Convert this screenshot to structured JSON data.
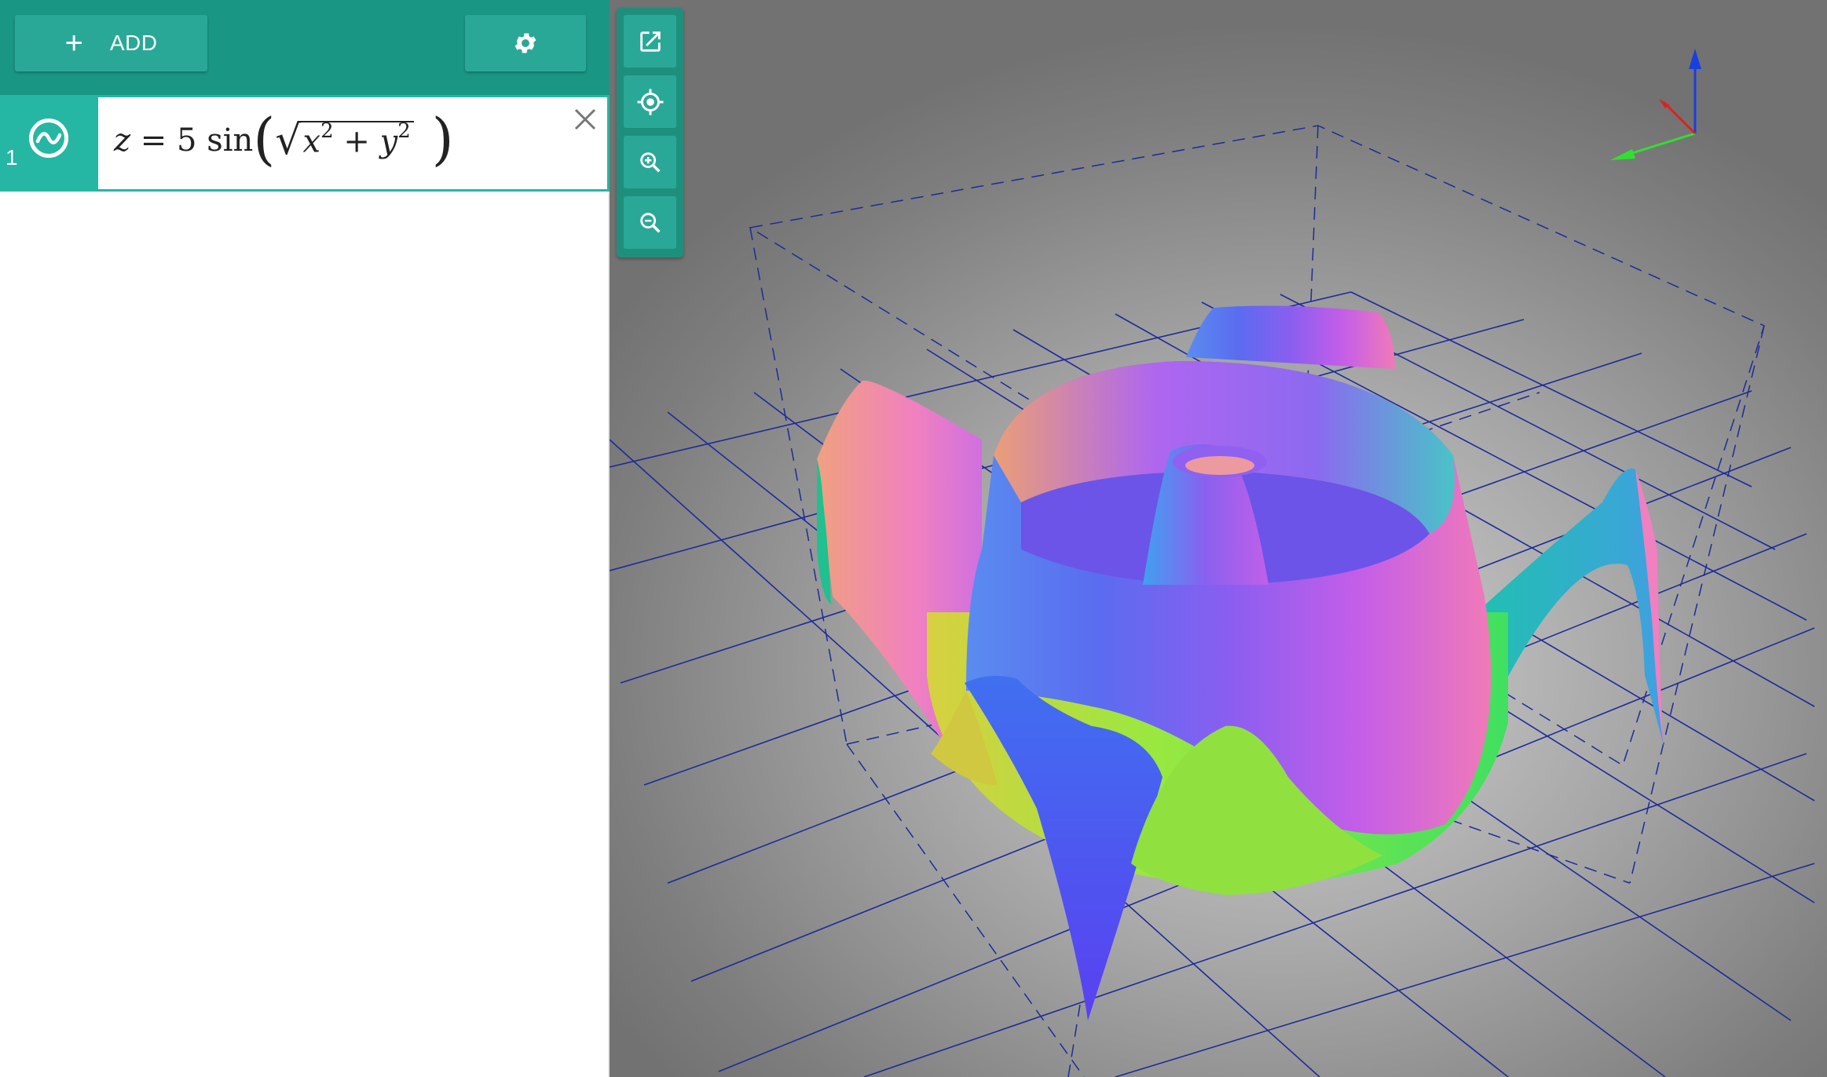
{
  "toolbar": {
    "add_label": "ADD",
    "add_icon": "plus-icon",
    "settings_icon": "gear-icon",
    "bg_color": "#1a9685",
    "button_color": "#2aa897"
  },
  "expressions": [
    {
      "index": "1",
      "latex": "z = 5 sin( √(x^2 + y^2) )",
      "visible": true,
      "color": "#25b7a3"
    }
  ],
  "view_tools": [
    {
      "name": "open-external-icon"
    },
    {
      "name": "center-target-icon"
    },
    {
      "name": "zoom-in-icon"
    },
    {
      "name": "zoom-out-icon"
    }
  ],
  "axes_gizmo": {
    "x_color": "#e02020",
    "y_color": "#30e030",
    "z_color": "#1a3fe0"
  },
  "graph": {
    "surface": "z = 5 sin(sqrt(x^2 + y^2))",
    "grid_color": "#1e2a9a"
  }
}
